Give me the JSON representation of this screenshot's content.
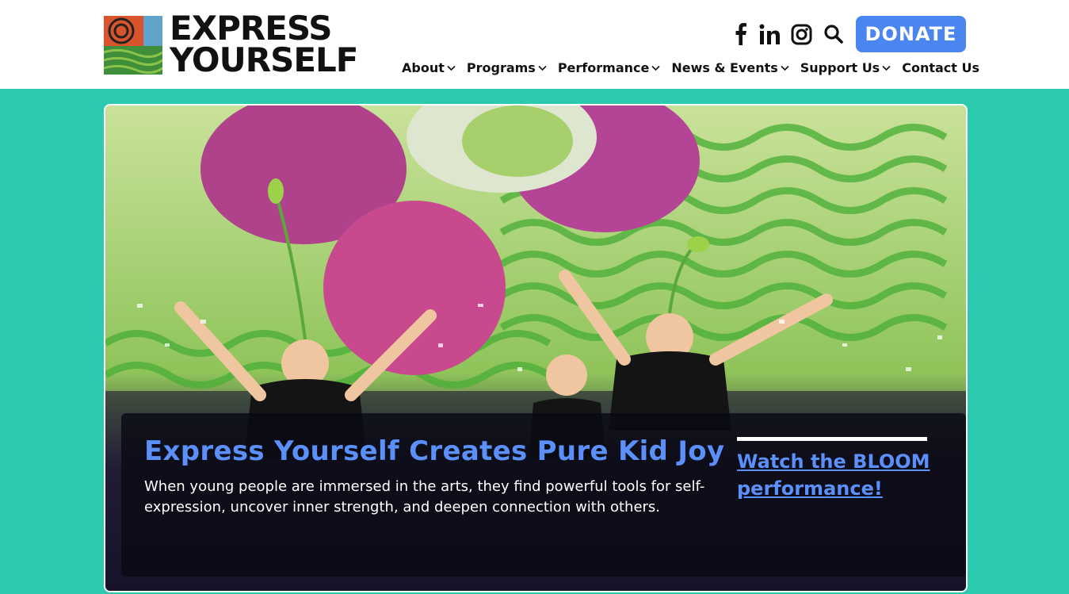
{
  "brand": {
    "line1": "EXPRESS",
    "line2": "YOURSELF"
  },
  "social": {
    "facebook_icon": "facebook-icon",
    "linkedin_icon": "linkedin-icon",
    "instagram_icon": "instagram-icon",
    "search_icon": "search-icon"
  },
  "donate_label": "DONATE",
  "nav": {
    "about": "About",
    "programs": "Programs",
    "performance": "Performance",
    "news_events": "News & Events",
    "support_us": "Support Us",
    "contact_us": "Contact Us"
  },
  "hero": {
    "headline": "Express Yourself Creates Pure Kid Joy",
    "subtext": "When young people are immersed in the arts, they find powerful tools for self-expression, uncover inner strength, and deepen connection with others.",
    "cta": "Watch the BLOOM performance!"
  },
  "colors": {
    "accent": "#4b86f0",
    "background": "#2bc9ad",
    "headline": "#5b8ff9"
  }
}
